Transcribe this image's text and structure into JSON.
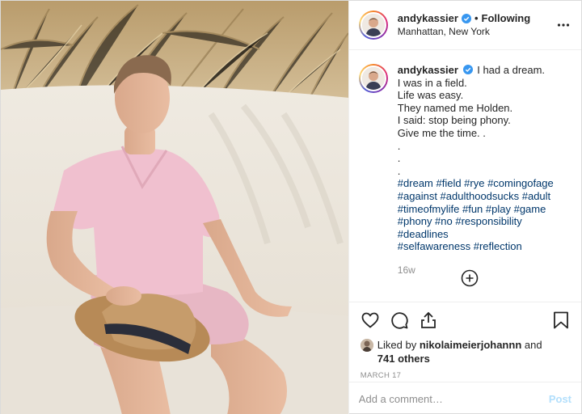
{
  "header": {
    "username": "andykassier",
    "separator": "•",
    "follow_state": "Following",
    "location": "Manhattan, New York",
    "more_icon": "more-horizontal-icon"
  },
  "caption": {
    "username": "andykassier",
    "lines": [
      "I had a dream.",
      "I was in a field.",
      "Life was easy.",
      "They named me Holden.",
      "I said: stop being phony.",
      "Give me the time. .",
      ".",
      ".",
      "."
    ],
    "hashtag_lines": [
      "#dream #field #rye #comingofage",
      "#against #adulthoodsucks #adult",
      "#timeofmylife #fun #play #game",
      "#phony #no #responsibility #deadlines",
      "#selfawareness #reflection"
    ],
    "age": "16w"
  },
  "actions": {
    "icons": [
      "heart-icon",
      "comment-icon",
      "share-icon",
      "bookmark-icon"
    ]
  },
  "likes": {
    "prefix": "Liked by",
    "user": "nikolaimeierjohannn",
    "joiner": "and",
    "others": "741 others"
  },
  "date": "MARCH 17",
  "comment": {
    "placeholder": "Add a comment…",
    "post_label": "Post"
  },
  "colors": {
    "verified": "#3897f0",
    "hashtag": "#00376b",
    "muted": "#8e8e8e",
    "post_disabled": "#b2dffc"
  }
}
